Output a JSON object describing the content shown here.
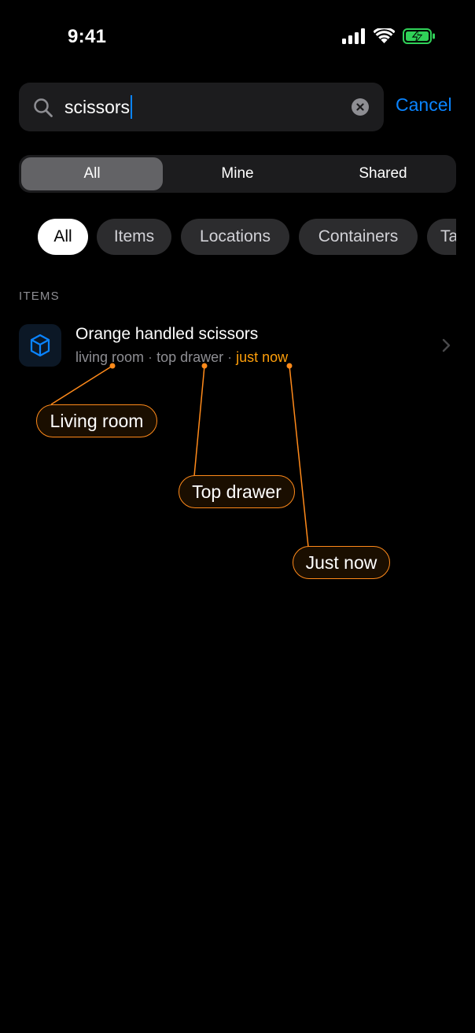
{
  "status_bar": {
    "time": "9:41",
    "icons": [
      "signal-icon",
      "wifi-icon",
      "battery-charging-icon"
    ],
    "battery_color": "#30d158"
  },
  "search": {
    "query": "scissors",
    "cancel_label": "Cancel",
    "accent_color": "#0a84ff"
  },
  "scope_tabs": [
    {
      "label": "All",
      "selected": true
    },
    {
      "label": "Mine",
      "selected": false
    },
    {
      "label": "Shared",
      "selected": false
    }
  ],
  "filter_chips": [
    {
      "label": "All",
      "selected": true
    },
    {
      "label": "Items",
      "selected": false
    },
    {
      "label": "Locations",
      "selected": false
    },
    {
      "label": "Containers",
      "selected": false
    },
    {
      "label": "Ta",
      "selected": false
    }
  ],
  "results": {
    "section_title": "ITEMS",
    "items": [
      {
        "icon": "box-icon",
        "title": "Orange handled scissors",
        "location": "living room",
        "container": "top drawer",
        "updated": "just now",
        "separator": "·"
      }
    ]
  },
  "annotations": [
    {
      "label": "Living room"
    },
    {
      "label": "Top drawer"
    },
    {
      "label": "Just now"
    }
  ],
  "colors": {
    "annotation": "#ff8a1a",
    "updated_text": "#ff9f0a"
  }
}
